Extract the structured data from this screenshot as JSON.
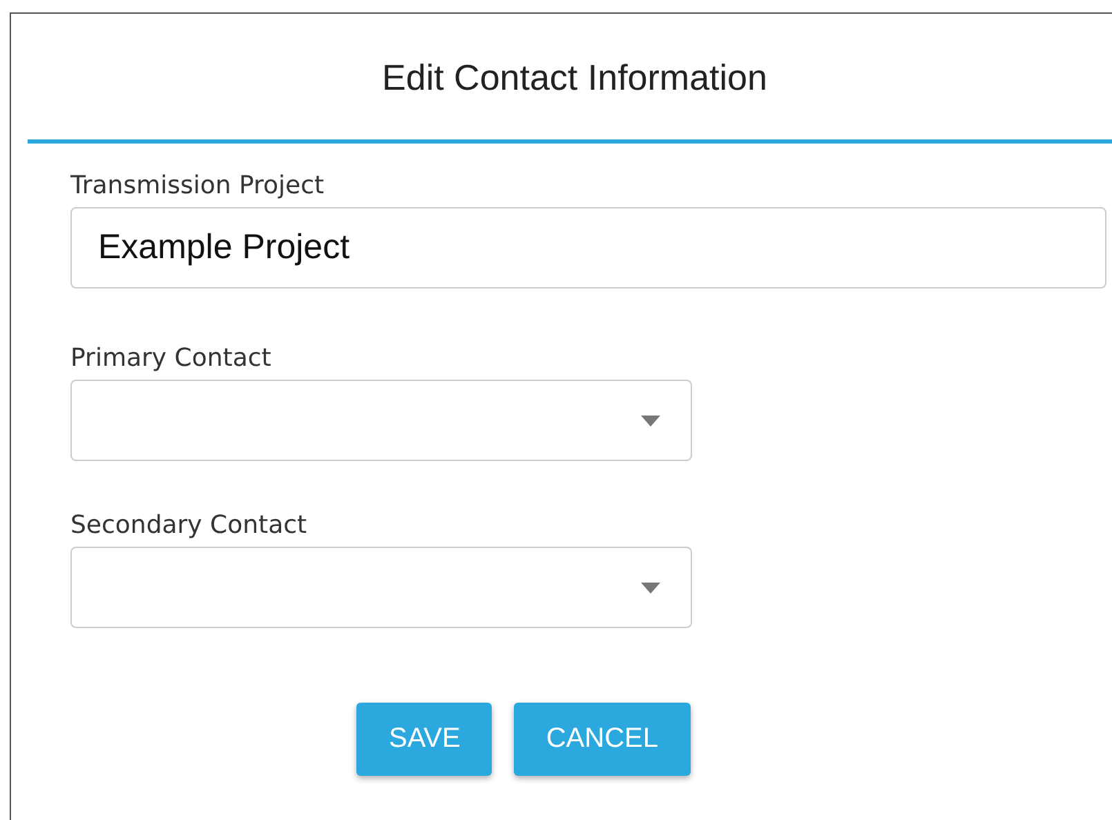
{
  "dialog": {
    "title": "Edit Contact Information"
  },
  "fields": [
    {
      "kind": "text",
      "label": "Transmission Project",
      "value": "Example Project"
    },
    {
      "kind": "select",
      "label": "Primary Contact"
    },
    {
      "kind": "select",
      "label": "Secondary Contact"
    }
  ],
  "buttons": [
    {
      "label": "SAVE"
    },
    {
      "label": "CANCEL"
    }
  ]
}
